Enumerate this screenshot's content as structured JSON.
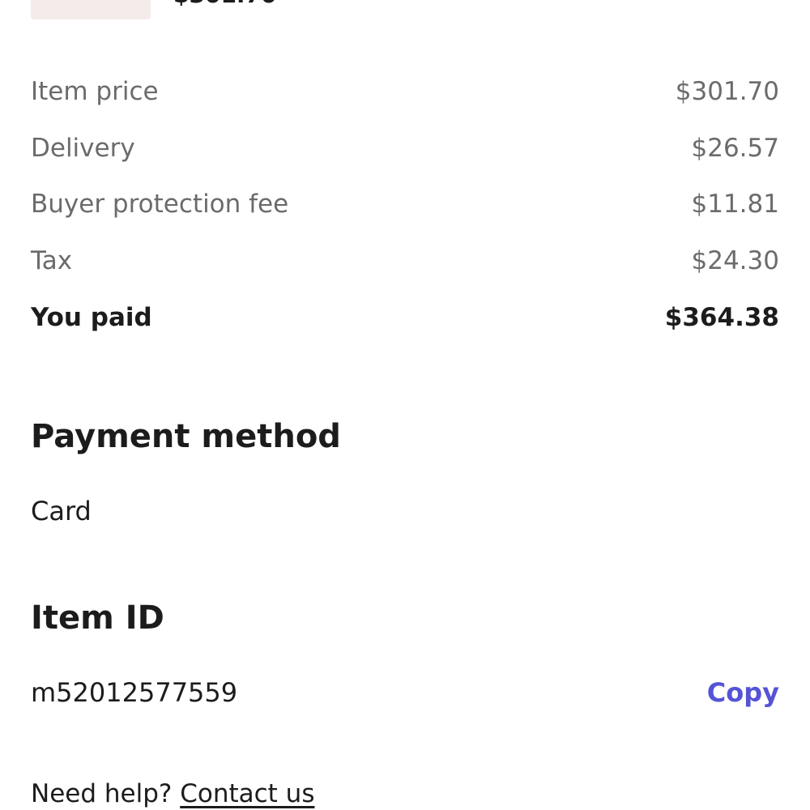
{
  "item": {
    "price": "$301.70"
  },
  "breakdown": [
    {
      "label": "Item price",
      "value": "$301.70"
    },
    {
      "label": "Delivery",
      "value": "$26.57"
    },
    {
      "label": "Buyer protection fee",
      "value": "$11.81"
    },
    {
      "label": "Tax",
      "value": "$24.30"
    }
  ],
  "total": {
    "label": "You paid",
    "value": "$364.38"
  },
  "payment": {
    "title": "Payment method",
    "method": "Card"
  },
  "item_id": {
    "title": "Item ID",
    "value": "m52012577559",
    "copy_label": "Copy"
  },
  "help": {
    "prompt": "Need help?",
    "link_label": "Contact us"
  },
  "colors": {
    "accent": "#5553d6",
    "muted_text": "#6b6b6b",
    "text": "#1c1c1c"
  }
}
